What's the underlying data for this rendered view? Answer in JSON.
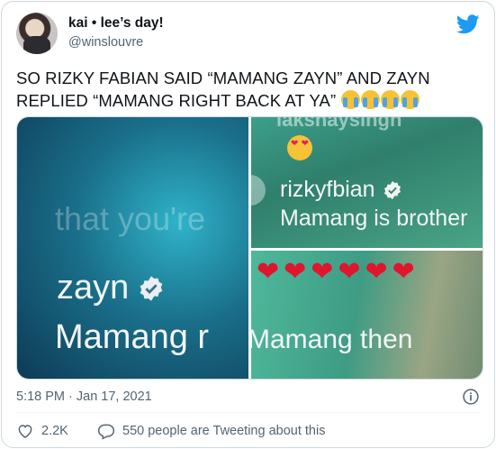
{
  "tweet": {
    "user": {
      "name": "kai • lee’s day!",
      "handle": "@winslouvre"
    },
    "text": "SO RIZKY FABIAN SAID “MAMANG ZAYN” AND ZAYN REPLIED “MAMANG RIGHT BACK AT YA”",
    "emoji_name": "loudly-crying-face",
    "emoji_count": 4,
    "media": {
      "left": {
        "ghost_text": "that you're",
        "username": "zayn",
        "caption": "Mamang r"
      },
      "top_right": {
        "top_text": "iaksnaysingh",
        "username": "rizkyfbian",
        "comment": "Mamang is brother"
      },
      "bottom_right": {
        "hearts": "❤❤❤❤❤❤",
        "comment": "Mamang then"
      }
    },
    "timestamp": "5:18 PM · Jan 17, 2021",
    "likes": "2.2K",
    "conversation_label": "550 people are Tweeting about this"
  },
  "colors": {
    "twitter_blue": "#1d9bf0",
    "text_primary": "#0f1419",
    "text_secondary": "#536471",
    "border": "#cfd9de"
  },
  "icons": [
    "twitter-bird-icon",
    "info-icon",
    "heart-icon",
    "reply-bubble-icon",
    "verified-badge-icon"
  ]
}
